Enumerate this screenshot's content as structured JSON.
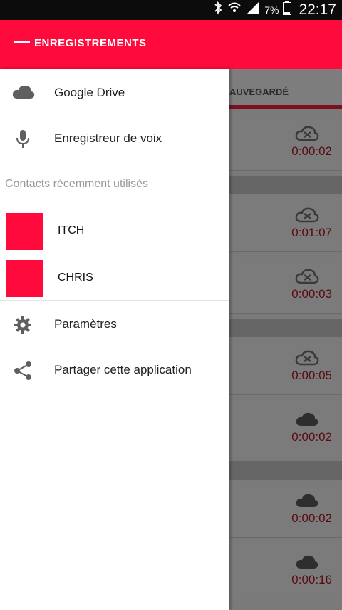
{
  "status": {
    "battery_pct": "7%",
    "time": "22:17"
  },
  "appbar": {
    "title": "ENREGISTREMENTS"
  },
  "background": {
    "tab_label": "AUVEGARDÉ",
    "rows": [
      {
        "duration": "0:00:02",
        "icon": "cloud-off-icon"
      },
      {
        "duration": "0:01:07",
        "icon": "cloud-off-icon"
      },
      {
        "duration": "0:00:03",
        "icon": "cloud-off-icon"
      },
      {
        "duration": "0:00:05",
        "icon": "cloud-off-icon"
      },
      {
        "duration": "0:00:02",
        "icon": "cloud-icon"
      },
      {
        "duration": "0:00:02",
        "icon": "cloud-icon"
      },
      {
        "duration": "0:00:16",
        "icon": "cloud-icon"
      }
    ]
  },
  "drawer": {
    "items_top": [
      {
        "label": "Google Drive",
        "icon": "cloud-icon"
      },
      {
        "label": "Enregistreur de voix",
        "icon": "microphone-icon"
      }
    ],
    "section_label": "Contacts récemment utilisés",
    "contacts": [
      {
        "name": "ITCH"
      },
      {
        "name": "CHRIS"
      }
    ],
    "items_bottom": [
      {
        "label": "Paramètres",
        "icon": "gear-icon"
      },
      {
        "label": "Partager cette application",
        "icon": "share-icon"
      }
    ]
  },
  "colors": {
    "accent": "#ff0a3c",
    "status_bar": "#0c0c0c",
    "duration_text": "#5a0a12"
  }
}
